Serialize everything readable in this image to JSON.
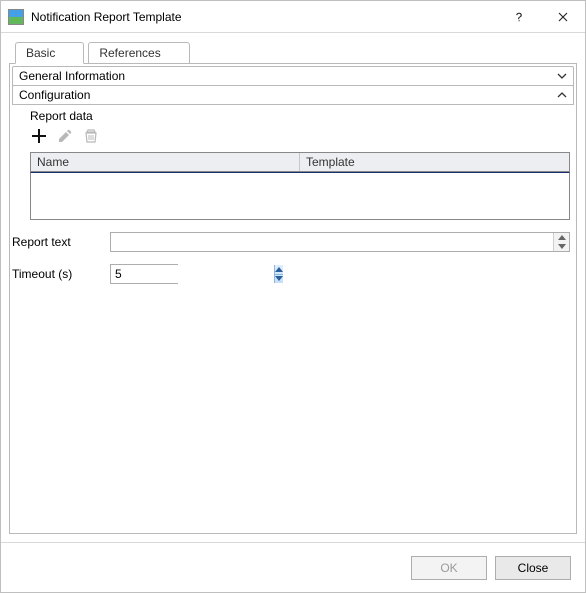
{
  "titlebar": {
    "title": "Notification Report Template"
  },
  "tabs": {
    "basic": "Basic",
    "references": "References"
  },
  "sections": {
    "general": {
      "label": "General Information",
      "expanded": false
    },
    "config": {
      "label": "Configuration",
      "expanded": true
    }
  },
  "config": {
    "report_data_label": "Report data",
    "table": {
      "col_name": "Name",
      "col_template": "Template"
    },
    "report_text_label": "Report text",
    "report_text_value": "",
    "timeout_label": "Timeout (s)",
    "timeout_value": "5"
  },
  "footer": {
    "ok": "OK",
    "close": "Close"
  }
}
